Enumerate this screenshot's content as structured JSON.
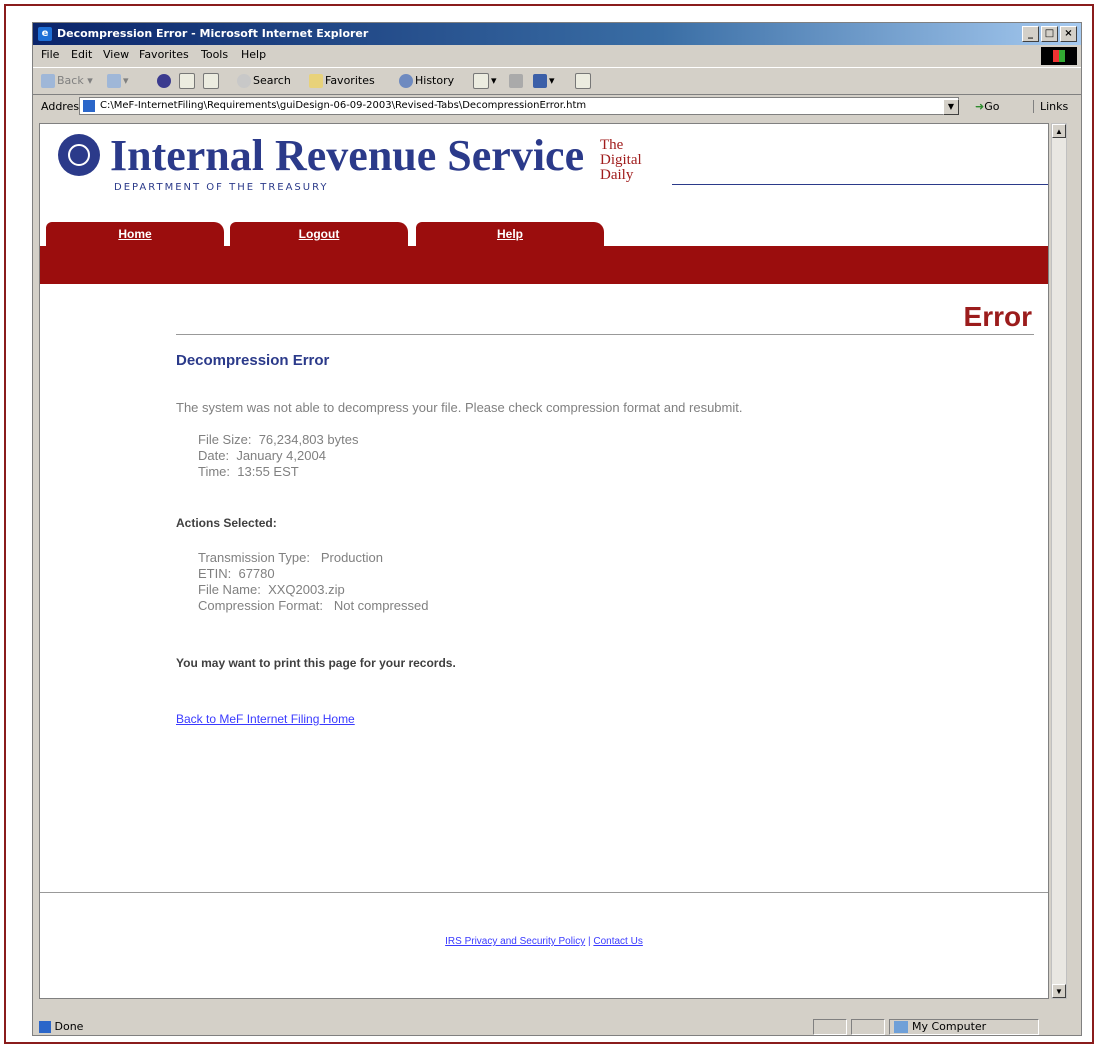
{
  "window": {
    "title": "Decompression Error - Microsoft Internet Explorer",
    "controls": {
      "minimize": "_",
      "maximize": "□",
      "close": "×"
    }
  },
  "menu": [
    "File",
    "Edit",
    "View",
    "Favorites",
    "Tools",
    "Help"
  ],
  "toolbar": {
    "back": "Back",
    "search": "Search",
    "favorites": "Favorites",
    "history": "History"
  },
  "address": {
    "label": "Address",
    "url": "C:\\MeF-InternetFiling\\Requirements\\guiDesign-06-09-2003\\Revised-Tabs\\DecompressionError.htm",
    "go": "Go",
    "links": "Links"
  },
  "header": {
    "agency": "Internal Revenue Service",
    "department": "DEPARTMENT OF THE TREASURY",
    "tagline": [
      "The",
      "Digital",
      "Daily"
    ]
  },
  "nav": {
    "tabs": [
      "Home",
      "Logout",
      "Help"
    ]
  },
  "page": {
    "heading": "Error",
    "section_title": "Decompression Error",
    "intro": "The system was not able to decompress your file. Please check compression format and resubmit.",
    "file_info": [
      {
        "label": "File Size:",
        "value": "76,234,803 bytes"
      },
      {
        "label": "Date:",
        "value": "January 4,2004"
      },
      {
        "label": "Time:",
        "value": "13:55 EST"
      }
    ],
    "actions_title": "Actions Selected:",
    "actions": [
      {
        "label": "Transmission Type:",
        "value": "Production"
      },
      {
        "label": "ETIN:",
        "value": "67780"
      },
      {
        "label": "File Name:",
        "value": "XXQ2003.zip"
      },
      {
        "label": "Compression Format:",
        "value": "Not compressed"
      }
    ],
    "print_note": "You may want to print this page for your records.",
    "back_link": "Back to MeF Internet Filing Home"
  },
  "footer": {
    "privacy": "IRS Privacy and Security Policy",
    "separator": "|",
    "contact": "Contact Us"
  },
  "status": {
    "text": "Done",
    "zone": "My Computer"
  },
  "colors": {
    "brand_red": "#9b0d0d",
    "brand_blue": "#2b3a8a",
    "link_blue": "#3a3aff"
  }
}
